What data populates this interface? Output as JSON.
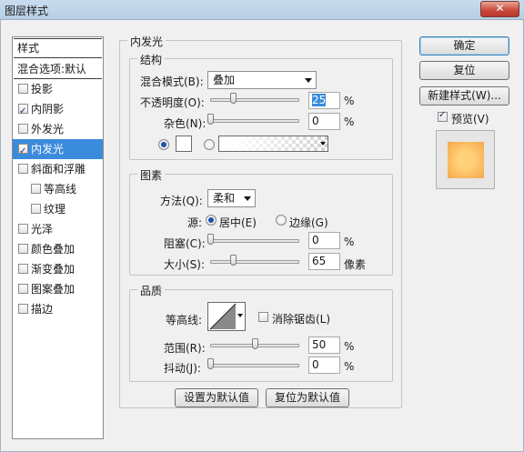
{
  "dialog": {
    "title": "图层样式",
    "close_label": "✕"
  },
  "stylelist": {
    "header": "样式",
    "blend": "混合选项:默认",
    "items": [
      {
        "label": "投影",
        "checked": false,
        "selected": false,
        "indent": false
      },
      {
        "label": "内阴影",
        "checked": true,
        "selected": false,
        "indent": false
      },
      {
        "label": "外发光",
        "checked": false,
        "selected": false,
        "indent": false
      },
      {
        "label": "内发光",
        "checked": true,
        "selected": true,
        "indent": false
      },
      {
        "label": "斜面和浮雕",
        "checked": false,
        "selected": false,
        "indent": false
      },
      {
        "label": "等高线",
        "checked": false,
        "selected": false,
        "indent": true
      },
      {
        "label": "纹理",
        "checked": false,
        "selected": false,
        "indent": true
      },
      {
        "label": "光泽",
        "checked": false,
        "selected": false,
        "indent": false
      },
      {
        "label": "颜色叠加",
        "checked": false,
        "selected": false,
        "indent": false
      },
      {
        "label": "渐变叠加",
        "checked": false,
        "selected": false,
        "indent": false
      },
      {
        "label": "图案叠加",
        "checked": false,
        "selected": false,
        "indent": false
      },
      {
        "label": "描边",
        "checked": false,
        "selected": false,
        "indent": false
      }
    ]
  },
  "panel": {
    "title": "内发光",
    "structure": {
      "title": "结构",
      "blend_mode_label": "混合模式(B):",
      "blend_mode_value": "叠加",
      "opacity_label": "不透明度(O):",
      "opacity_value": "25",
      "opacity_fraction": 0.25,
      "noise_label": "杂色(N):",
      "noise_value": "0",
      "noise_fraction": 0,
      "percent": "%"
    },
    "elements": {
      "title": "图素",
      "technique_label": "方法(Q):",
      "technique_value": "柔和",
      "source_label": "源:",
      "source_center": "居中(E)",
      "source_edge": "边缘(G)",
      "choke_label": "阻塞(C):",
      "choke_value": "0",
      "choke_fraction": 0,
      "size_label": "大小(S):",
      "size_value": "65",
      "size_fraction": 0.26,
      "percent": "%",
      "pixels": "像素"
    },
    "quality": {
      "title": "品质",
      "contour_label": "等高线:",
      "antialias_label": "消除锯齿(L)",
      "antialias_checked": false,
      "range_label": "范围(R):",
      "range_value": "50",
      "range_fraction": 0.5,
      "jitter_label": "抖动(J):",
      "jitter_value": "0",
      "jitter_fraction": 0,
      "percent": "%"
    },
    "make_default": "设置为默认值",
    "reset_default": "复位为默认值"
  },
  "buttons": {
    "ok": "确定",
    "reset": "复位",
    "new_style": "新建样式(W)...",
    "preview_label": "预览(V)",
    "preview_checked": true
  },
  "colors": {
    "selection": "#3b8bdc",
    "preview_center": "#ffd27a",
    "preview_edge": "#f7a64a"
  }
}
